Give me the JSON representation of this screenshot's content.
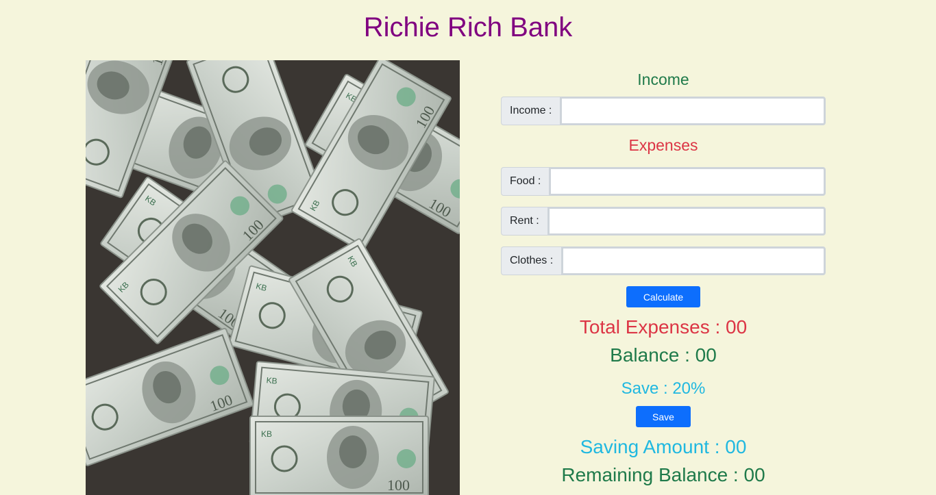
{
  "page": {
    "title": "Richie Rich Bank"
  },
  "income": {
    "heading": "Income",
    "label": "Income :",
    "value": ""
  },
  "expenses": {
    "heading": "Expenses",
    "fields": [
      {
        "label": "Food :",
        "value": ""
      },
      {
        "label": "Rent :",
        "value": ""
      },
      {
        "label": "Clothes :",
        "value": ""
      }
    ]
  },
  "actions": {
    "calculate_label": "Calculate",
    "save_label": "Save"
  },
  "results": {
    "total_expenses": "Total Expenses : 00",
    "balance": "Balance : 00",
    "save_percent": "Save : 20%",
    "saving_amount": "Saving Amount : 00",
    "remaining_balance": "Remaining Balance : 00"
  },
  "hero_image": {
    "icon": "money-bills-image"
  },
  "colors": {
    "background": "#f5f5dc",
    "title": "#800080",
    "income": "#1f7a4a",
    "expenses": "#dc3545",
    "save": "#20b8e0",
    "button": "#0d6efd"
  }
}
